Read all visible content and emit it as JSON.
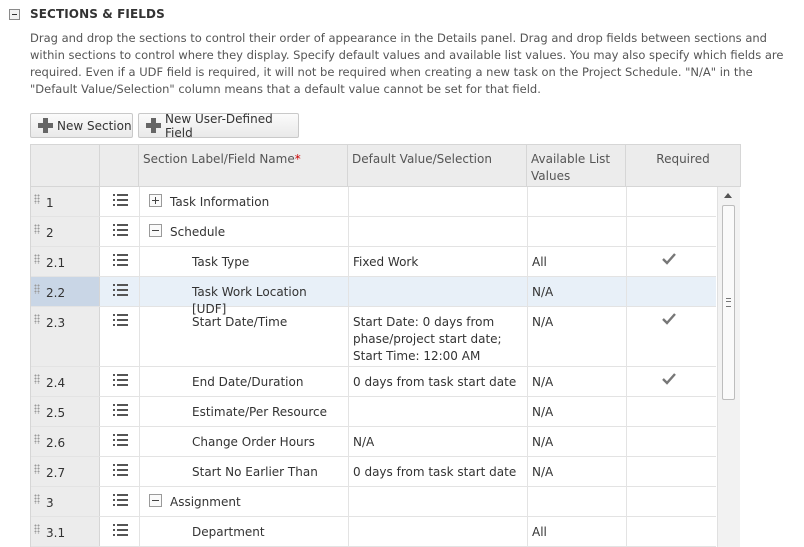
{
  "section": {
    "title": "SECTIONS & FIELDS",
    "description": "Drag and drop the sections to control their order of appearance in the Details panel. Drag and drop fields between sections and within sections to control where they display. Specify default values and available list values. You may also specify which fields are required. Even if a UDF field is required, it will not be required when creating a new task on the Project Schedule. \"N/A\" in the \"Default Value/Selection\" column means that a default value cannot be set for that field."
  },
  "toolbar": {
    "new_section": "New Section",
    "new_udf": "New User-Defined Field"
  },
  "columns": {
    "label": "Section Label/Field Name",
    "required_star": "*",
    "default": "Default Value/Selection",
    "available": "Available List Values",
    "required": "Required"
  },
  "rows": [
    {
      "num": "1",
      "type": "section",
      "expanded": false,
      "label": "Task Information",
      "default": "",
      "available": "",
      "required": false
    },
    {
      "num": "2",
      "type": "section",
      "expanded": true,
      "label": "Schedule",
      "default": "",
      "available": "",
      "required": false
    },
    {
      "num": "2.1",
      "type": "field",
      "label": "Task Type",
      "default": "Fixed Work",
      "available": "All",
      "required": true
    },
    {
      "num": "2.2",
      "type": "field",
      "label": "Task Work Location [UDF]",
      "default": "",
      "available": "N/A",
      "required": false,
      "selected": true
    },
    {
      "num": "2.3",
      "type": "field",
      "label": "Start Date/Time",
      "default": "Start Date: 0 days from phase/project start date; Start Time: 12:00 AM",
      "available": "N/A",
      "required": true
    },
    {
      "num": "2.4",
      "type": "field",
      "label": "End Date/Duration",
      "default": "0 days from task start date",
      "available": "N/A",
      "required": true
    },
    {
      "num": "2.5",
      "type": "field",
      "label": "Estimate/Per Resource",
      "default": "",
      "available": "N/A",
      "required": false
    },
    {
      "num": "2.6",
      "type": "field",
      "label": "Change Order Hours",
      "default": "N/A",
      "available": "N/A",
      "required": false
    },
    {
      "num": "2.7",
      "type": "field",
      "label": "Start No Earlier Than",
      "default": "0 days from task start date",
      "available": "N/A",
      "required": false
    },
    {
      "num": "3",
      "type": "section",
      "expanded": true,
      "label": "Assignment",
      "default": "",
      "available": "",
      "required": false
    },
    {
      "num": "3.1",
      "type": "field",
      "label": "Department",
      "default": "",
      "available": "All",
      "required": false
    }
  ],
  "colors": {
    "header_bg": "#ececec",
    "selected_row": "#e8f0f8",
    "required_star": "#cc0000"
  }
}
